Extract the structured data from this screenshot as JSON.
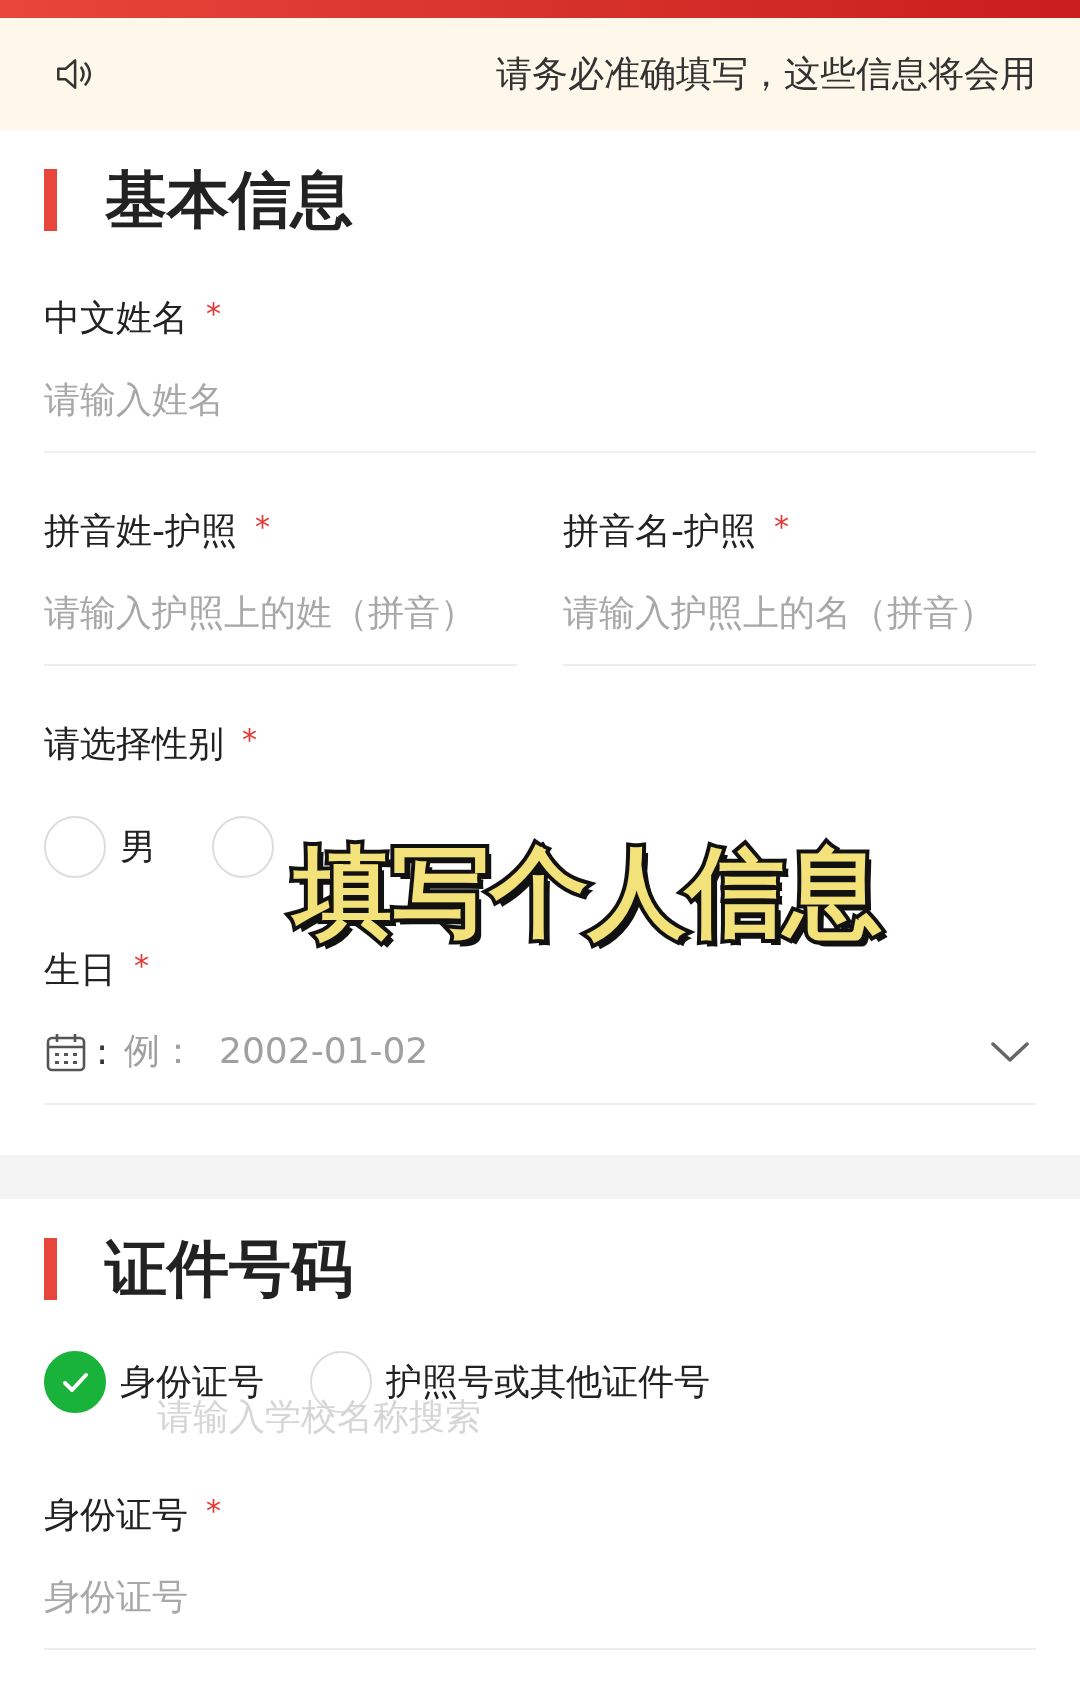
{
  "notice": {
    "text": "请务必准确填写，这些信息将会用"
  },
  "sections": [
    {
      "title": "基本信息",
      "rows": [
        {
          "kind": "input",
          "label": "中文姓名",
          "required_mark": "*",
          "placeholder": "请输入姓名"
        },
        {
          "kind": "pair",
          "items": [
            {
              "label": "拼音姓-护照",
              "required_mark": "*",
              "placeholder": "请输入护照上的姓（拼音）"
            },
            {
              "label": "拼音名-护照",
              "required_mark": "*",
              "placeholder": "请输入护照上的名（拼音）"
            }
          ]
        },
        {
          "kind": "radio",
          "label": "请选择性别",
          "required_mark": "*",
          "options": [
            {
              "label": "男",
              "selected": false
            },
            {
              "selected": false
            }
          ]
        },
        {
          "kind": "date",
          "label": "生日",
          "required_mark": "*",
          "separator": ":",
          "placeholder": "例：  2002-01-02"
        }
      ]
    },
    {
      "title": "证件号码",
      "rows": [
        {
          "kind": "choice",
          "options": [
            {
              "label": "身份证号",
              "selected": true
            },
            {
              "label": "护照号或其他证件号",
              "selected": false
            }
          ]
        },
        {
          "kind": "ghost",
          "text": "请输入学校名称搜索"
        },
        {
          "kind": "input",
          "label": "身份证号",
          "required_mark": "*",
          "placeholder": "身份证号"
        }
      ]
    }
  ],
  "caption": "填写个人信息"
}
